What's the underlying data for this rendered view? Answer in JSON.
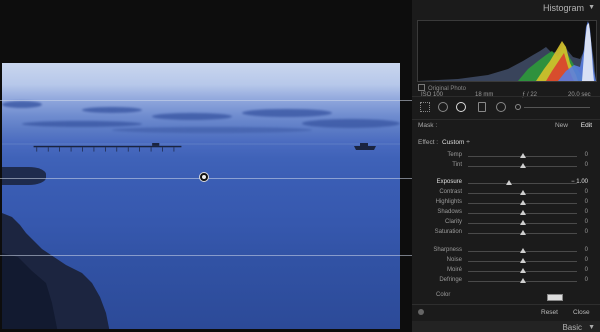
{
  "histogram": {
    "title": "Histogram",
    "collapse_arrow": "▼",
    "iso": "ISO 100",
    "focal": "18 mm",
    "aperture": "ƒ / 22",
    "shutter": "20.0 sec",
    "original_photo": "Original Photo"
  },
  "mask": {
    "label": "Mask :",
    "new": "New",
    "edit": "Edit"
  },
  "effect": {
    "label": "Effect :",
    "value": "Custom ÷"
  },
  "sliders": [
    {
      "label": "Temp",
      "value": "0",
      "level": 0.5
    },
    {
      "label": "Tint",
      "value": "0",
      "level": 0.5
    },
    {
      "label": "Exposure",
      "value": "− 1.00",
      "level": 0.375,
      "active": true
    },
    {
      "label": "Contrast",
      "value": "0",
      "level": 0.5
    },
    {
      "label": "Highlights",
      "value": "0",
      "level": 0.5
    },
    {
      "label": "Shadows",
      "value": "0",
      "level": 0.5
    },
    {
      "label": "Clarity",
      "value": "0",
      "level": 0.5
    },
    {
      "label": "Saturation",
      "value": "0",
      "level": 0.5
    },
    {
      "label": "Sharpness",
      "value": "0",
      "level": 0.5
    },
    {
      "label": "Noise",
      "value": "0",
      "level": 0.5
    },
    {
      "label": "Moiré",
      "value": "0",
      "level": 0.5
    },
    {
      "label": "Defringe",
      "value": "0",
      "level": 0.5
    }
  ],
  "color": {
    "label": "Color"
  },
  "bottom": {
    "reset": "Reset",
    "close": "Close"
  },
  "basic": {
    "title": "Basic",
    "arrow": "▼"
  }
}
